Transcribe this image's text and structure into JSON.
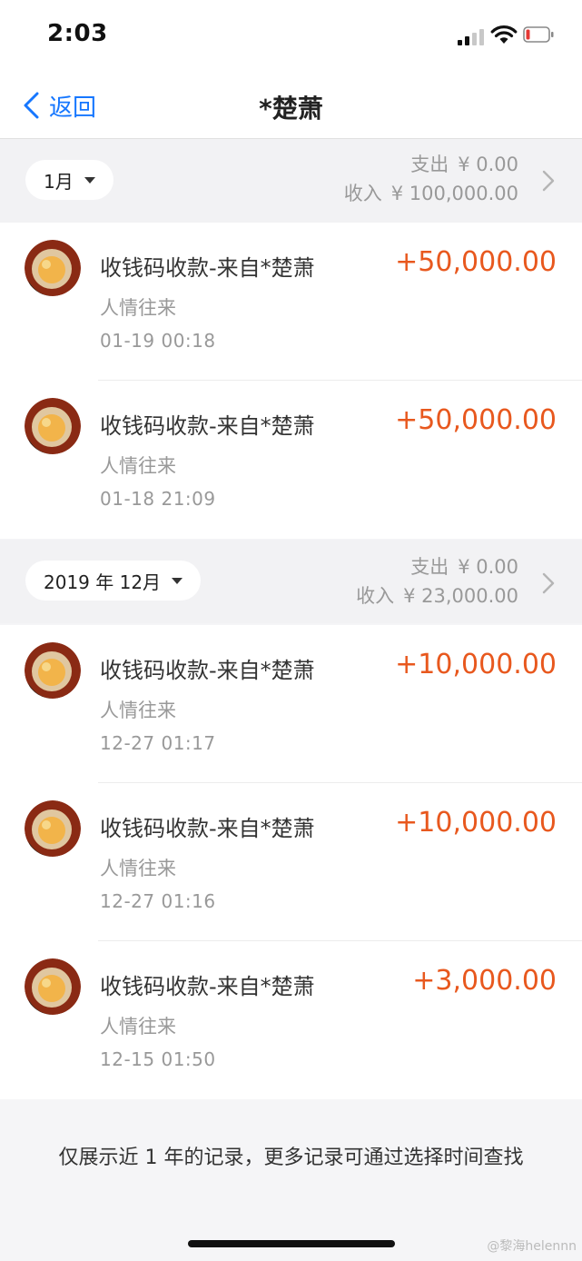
{
  "status_bar": {
    "time": "2:03",
    "battery_color": "#e53935"
  },
  "nav": {
    "back_label": "返回",
    "title": "*楚萧"
  },
  "sections": [
    {
      "month_label": "1月",
      "expense_label": "支出",
      "expense_value": "¥ 0.00",
      "income_label": "收入",
      "income_value": "¥ 100,000.00",
      "records": [
        {
          "title": "收钱码收款-来自*楚萧",
          "category": "人情往来",
          "time": "01-19  00:18",
          "amount": "+50,000.00"
        },
        {
          "title": "收钱码收款-来自*楚萧",
          "category": "人情往来",
          "time": "01-18  21:09",
          "amount": "+50,000.00"
        }
      ]
    },
    {
      "month_label": "2019 年 12月",
      "expense_label": "支出",
      "expense_value": "¥ 0.00",
      "income_label": "收入",
      "income_value": "¥ 23,000.00",
      "records": [
        {
          "title": "收钱码收款-来自*楚萧",
          "category": "人情往来",
          "time": "12-27  01:17",
          "amount": "+10,000.00"
        },
        {
          "title": "收钱码收款-来自*楚萧",
          "category": "人情往来",
          "time": "12-27  01:16",
          "amount": "+10,000.00"
        },
        {
          "title": "收钱码收款-来自*楚萧",
          "category": "人情往来",
          "time": "12-15  01:50",
          "amount": "+3,000.00"
        }
      ]
    }
  ],
  "footer_note": "仅展示近 1 年的记录，更多记录可通过选择时间查找",
  "watermark": "@黎海helennn",
  "colors": {
    "accent": "#1677ff",
    "amount": "#e8581e"
  },
  "icons": {
    "back": "chevron-left-icon",
    "section_more": "chevron-right-icon",
    "dropdown": "caret-down-icon"
  }
}
